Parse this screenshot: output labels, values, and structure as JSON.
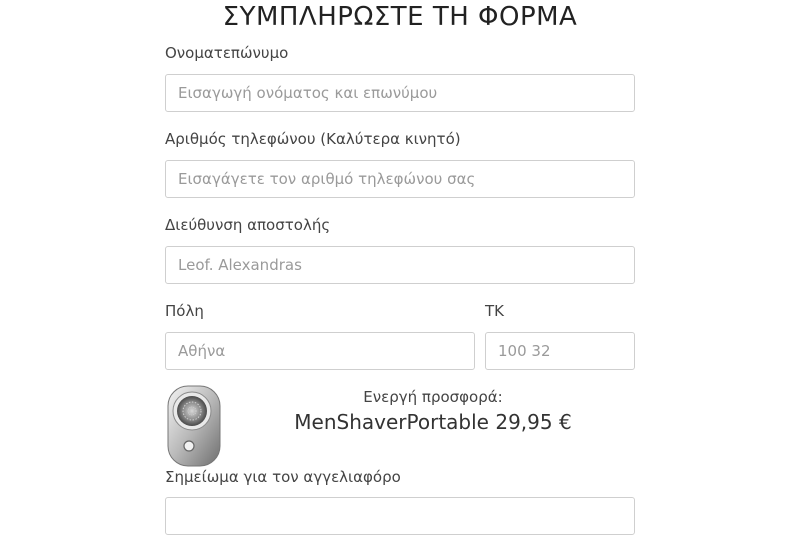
{
  "form": {
    "title": "ΣΥΜΠΛΗΡΩΣΤΕ ΤΗ ΦΟΡΜΑ",
    "name_label": "Ονοματεπώνυμο",
    "name_placeholder": "Εισαγωγή ονόματος και επωνύμου",
    "phone_label": "Αριθμός τηλεφώνου (Καλύτερα κινητό)",
    "phone_placeholder": "Εισαγάγετε τον αριθμό τηλεφώνου σας",
    "address_label": "Διεύθυνση αποστολής",
    "address_placeholder": "Leof. Alexandras",
    "city_label": "Πόλη",
    "city_placeholder": "Αθήνα",
    "zip_label": "ΤΚ",
    "zip_placeholder": "100 32",
    "note_label": "Σημείωμα για τον αγγελιαφόρο"
  },
  "offer": {
    "label": "Ενεργή προσφορά:",
    "product_price": "MenShaverPortable 29,95 €",
    "image_icon": "portable-shaver-image"
  }
}
